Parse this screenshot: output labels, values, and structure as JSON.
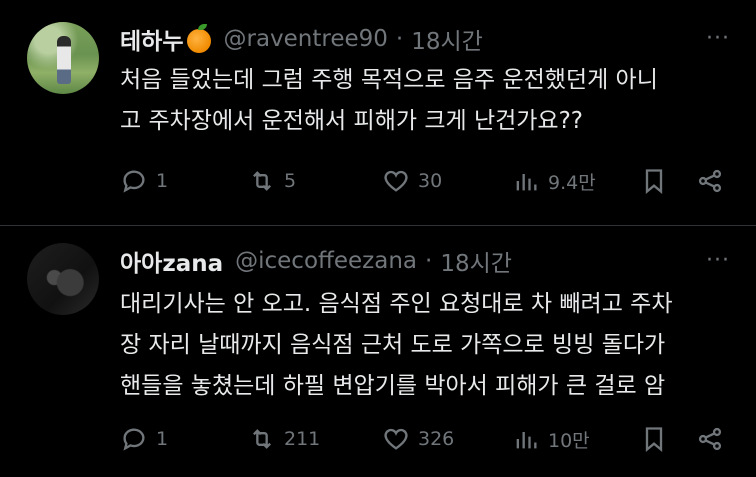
{
  "tweets": [
    {
      "display_name": "테하누",
      "badge_icon": "orange-emoji-icon",
      "handle": "@raventree90",
      "separator": "·",
      "time": "18시간",
      "more": "···",
      "lines": [
        "처음 들었는데 그럼 주행 목적으로 음주 운전했던게 아니",
        "고 주차장에서 운전해서 피해가 크게 난건가요??"
      ],
      "replies": "1",
      "retweets": "5",
      "likes": "30",
      "views": "9.4만"
    },
    {
      "display_name": "아아zana",
      "handle": "@icecoffeezana",
      "separator": "·",
      "time": "18시간",
      "more": "···",
      "lines": [
        "대리기사는 안 오고. 음식점 주인 요청대로 차 빼려고 주차",
        "장 자리 날때까지 음식점 근처 도로 가쪽으로 빙빙 돌다가",
        "핸들을 놓쳤는데 하필 변압기를 박아서 피해가 큰 걸로 암"
      ],
      "replies": "1",
      "retweets": "211",
      "likes": "326",
      "views": "10만"
    }
  ]
}
